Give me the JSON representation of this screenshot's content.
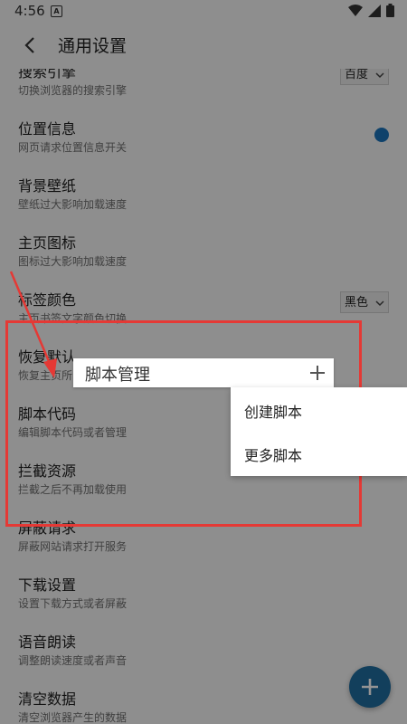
{
  "status_bar": {
    "time": "4:56",
    "notification_letter": "A"
  },
  "header": {
    "title": "通用设置"
  },
  "settings": [
    {
      "title": "搜索引擎",
      "subtitle": "切换浏览器的搜索引擎",
      "control": "dropdown",
      "value": "百度"
    },
    {
      "title": "位置信息",
      "subtitle": "网页请求位置信息开关",
      "control": "toggle"
    },
    {
      "title": "背景壁纸",
      "subtitle": "壁纸过大影响加载速度"
    },
    {
      "title": "主页图标",
      "subtitle": "图标过大影响加载速度"
    },
    {
      "title": "标签颜色",
      "subtitle": "主页书签文字颜色切换",
      "control": "dropdown",
      "value": "黑色"
    },
    {
      "title": "恢复默认",
      "subtitle": "恢复主页所"
    },
    {
      "title": "脚本代码",
      "subtitle": "编辑脚本代码或者管理"
    },
    {
      "title": "拦截资源",
      "subtitle": "拦截之后不再加载使用"
    },
    {
      "title": "屏蔽请求",
      "subtitle": "屏蔽网站请求打开服务"
    },
    {
      "title": "下载设置",
      "subtitle": "设置下载方式或者屏蔽"
    },
    {
      "title": "语音朗读",
      "subtitle": "调整朗读速度或者声音"
    },
    {
      "title": "清空数据",
      "subtitle": "清空浏览器产生的数据"
    }
  ],
  "popup": {
    "title": "脚本管理",
    "menu_items": [
      "创建脚本",
      "更多脚本"
    ]
  },
  "colors": {
    "accent": "#1a73b8",
    "annotation": "#e53935"
  }
}
